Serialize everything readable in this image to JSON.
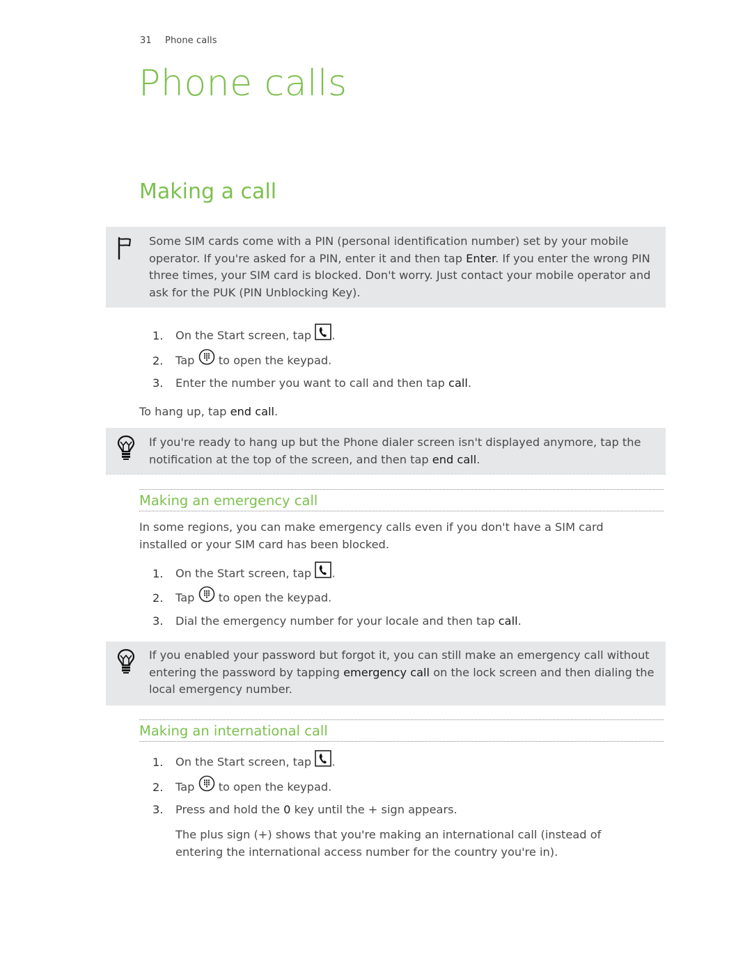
{
  "header": {
    "page_number": "31",
    "chapter": "Phone calls"
  },
  "chapter_title": "Phone calls",
  "section_title": "Making a call",
  "pin_note": {
    "icon": "flag-icon",
    "part1": "Some SIM cards come with a PIN (personal identification number) set by your mobile operator. If you're asked for a PIN, enter it and then tap ",
    "keyword": "Enter",
    "part2": ". If you enter the wrong PIN three times, your SIM card is blocked. Don't worry. Just contact your mobile operator and ask for the PUK (PIN Unblocking Key)."
  },
  "make_call_steps": [
    {
      "num": "1.",
      "before": "On the Start screen, tap ",
      "icon": "phone-tile-icon",
      "after": "."
    },
    {
      "num": "2.",
      "before": "Tap ",
      "icon": "keypad-icon",
      "after": " to open the keypad."
    },
    {
      "num": "3.",
      "before": "Enter the number you want to call and then tap ",
      "keyword": "call",
      "after": "."
    }
  ],
  "hang_up": {
    "before": "To hang up, tap ",
    "keyword": "end call",
    "after": "."
  },
  "tip_hangup": {
    "icon": "lightbulb-icon",
    "part1": "If you're ready to hang up but the Phone dialer screen isn't displayed anymore, tap the notification at the top of the screen, and then tap ",
    "keyword": "end call",
    "part2": "."
  },
  "emergency": {
    "title": "Making an emergency call",
    "intro": "In some regions, you can make emergency calls even if you don't have a SIM card installed or your SIM card has been blocked.",
    "steps": [
      {
        "num": "1.",
        "before": "On the Start screen, tap ",
        "icon": "phone-tile-icon",
        "after": "."
      },
      {
        "num": "2.",
        "before": "Tap ",
        "icon": "keypad-icon",
        "after": " to open the keypad."
      },
      {
        "num": "3.",
        "before": "Dial the emergency number for your locale and then tap ",
        "keyword": "call",
        "after": "."
      }
    ],
    "tip": {
      "icon": "lightbulb-icon",
      "part1": "If you enabled your password but forgot it, you can still make an emergency call without entering the password by tapping ",
      "keyword": "emergency call",
      "part2": " on the lock screen and then dialing the local emergency number."
    }
  },
  "international": {
    "title": "Making an international call",
    "steps": [
      {
        "num": "1.",
        "before": "On the Start screen, tap ",
        "icon": "phone-tile-icon",
        "after": "."
      },
      {
        "num": "2.",
        "before": "Tap ",
        "icon": "keypad-icon",
        "after": " to open the keypad."
      },
      {
        "num": "3.",
        "before": "Press and hold the ",
        "keyword": "0",
        "after": " key until the + sign appears."
      }
    ],
    "note": "The plus sign (+) shows that you're making an international call (instead of entering the international access number for the country you're in)."
  },
  "colors": {
    "accent_green": "#7cc04e",
    "note_bg": "#e6e7e8",
    "text": "#4a4a4a"
  }
}
